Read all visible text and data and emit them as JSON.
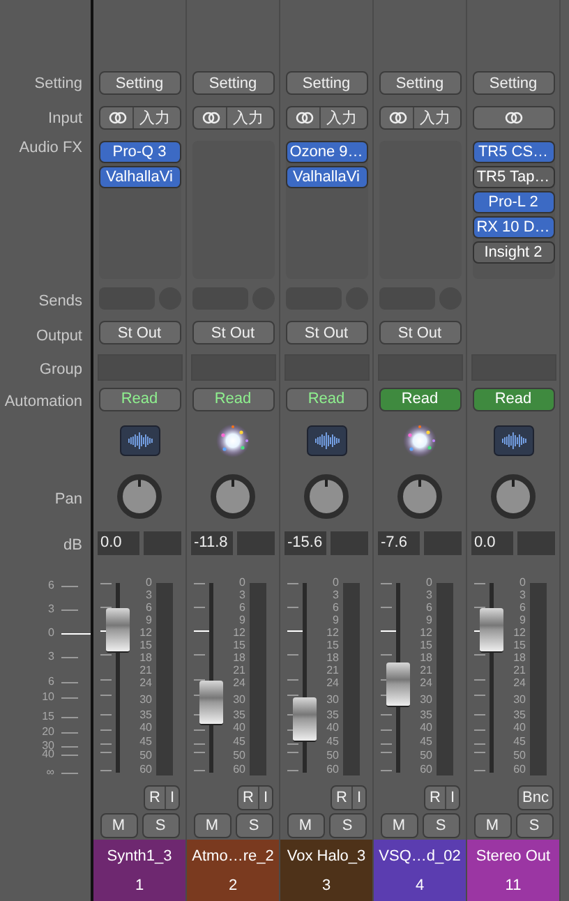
{
  "row_labels": {
    "setting": "Setting",
    "input": "Input",
    "audio_fx": "Audio FX",
    "sends": "Sends",
    "output": "Output",
    "group": "Group",
    "automation": "Automation",
    "pan": "Pan",
    "db": "dB"
  },
  "fader_scale": [
    "6",
    "3",
    "0",
    "3",
    "6",
    "10",
    "15",
    "20",
    "30",
    "40",
    "∞"
  ],
  "strips": [
    {
      "kind": "track",
      "setting": "Setting",
      "input": "入力",
      "plugins": [
        {
          "name": "Pro-Q 3",
          "enabled": true
        },
        {
          "name": "ValhallaVi",
          "enabled": true
        }
      ],
      "output": "St Out",
      "automation": {
        "label": "Read",
        "active": false
      },
      "volume": "0.0",
      "level": 0.75,
      "meter_scale": [
        "0",
        "3",
        "6",
        "9",
        "12",
        "15",
        "18",
        "21",
        "24",
        "30",
        "35",
        "40",
        "45",
        "50",
        "60"
      ],
      "record": "R",
      "input_monitor": "I",
      "mute": "M",
      "solo": "S",
      "name": "Synth1_3",
      "number": "1",
      "color": "#6e2870"
    },
    {
      "kind": "track",
      "setting": "Setting",
      "input": "入力",
      "output": "St Out",
      "automation": {
        "label": "Read",
        "active": false
      },
      "volume": "-11.8",
      "level": 0.37,
      "meter_scale": [
        "0",
        "3",
        "6",
        "9",
        "12",
        "15",
        "18",
        "21",
        "24",
        "30",
        "35",
        "40",
        "45",
        "50",
        "60"
      ],
      "record": "R",
      "input_monitor": "I",
      "mute": "M",
      "solo": "S",
      "name": "Atmo…re_2",
      "number": "2",
      "color": "#7a3a1f"
    },
    {
      "kind": "track",
      "setting": "Setting",
      "input": "入力",
      "plugins": [
        {
          "name": "Ozone 9…",
          "enabled": true
        },
        {
          "name": "ValhallaVi",
          "enabled": true
        }
      ],
      "output": "St Out",
      "automation": {
        "label": "Read",
        "active": false
      },
      "volume": "-15.6",
      "level": 0.28,
      "meter_scale": [
        "0",
        "3",
        "6",
        "9",
        "12",
        "15",
        "18",
        "21",
        "24",
        "30",
        "35",
        "40",
        "45",
        "50",
        "60"
      ],
      "record": "R",
      "input_monitor": "I",
      "mute": "M",
      "solo": "S",
      "name": "Vox Halo_3",
      "number": "3",
      "color": "#4e3219"
    },
    {
      "kind": "track",
      "setting": "Setting",
      "input": "入力",
      "output": "St Out",
      "automation": {
        "label": "Read",
        "active": true
      },
      "volume": "-7.6",
      "level": 0.46,
      "meter_scale": [
        "0",
        "3",
        "6",
        "9",
        "12",
        "15",
        "18",
        "21",
        "24",
        "30",
        "35",
        "40",
        "45",
        "50",
        "60"
      ],
      "record": "R",
      "input_monitor": "I",
      "mute": "M",
      "solo": "S",
      "name": "VSQ…d_02",
      "number": "4",
      "color": "#5b3db0"
    },
    {
      "kind": "output",
      "setting": "Setting",
      "plugins": [
        {
          "name": "TR5 CS…",
          "enabled": true
        },
        {
          "name": "TR5 Tap…",
          "enabled": false
        },
        {
          "name": "Pro-L 2",
          "enabled": true
        },
        {
          "name": "RX 10 D…",
          "enabled": true
        },
        {
          "name": "Insight 2",
          "enabled": false
        }
      ],
      "automation": {
        "label": "Read",
        "active": true
      },
      "volume": "0.0",
      "level": 0.75,
      "meter_scale": [
        "0",
        "3",
        "6",
        "9",
        "12",
        "15",
        "18",
        "21",
        "24",
        "30",
        "35",
        "40",
        "45",
        "50",
        "60"
      ],
      "bounce": "Bnc",
      "mute": "M",
      "solo": "S",
      "name": "Stereo Out",
      "number": "11",
      "color": "#9b36a3"
    }
  ]
}
